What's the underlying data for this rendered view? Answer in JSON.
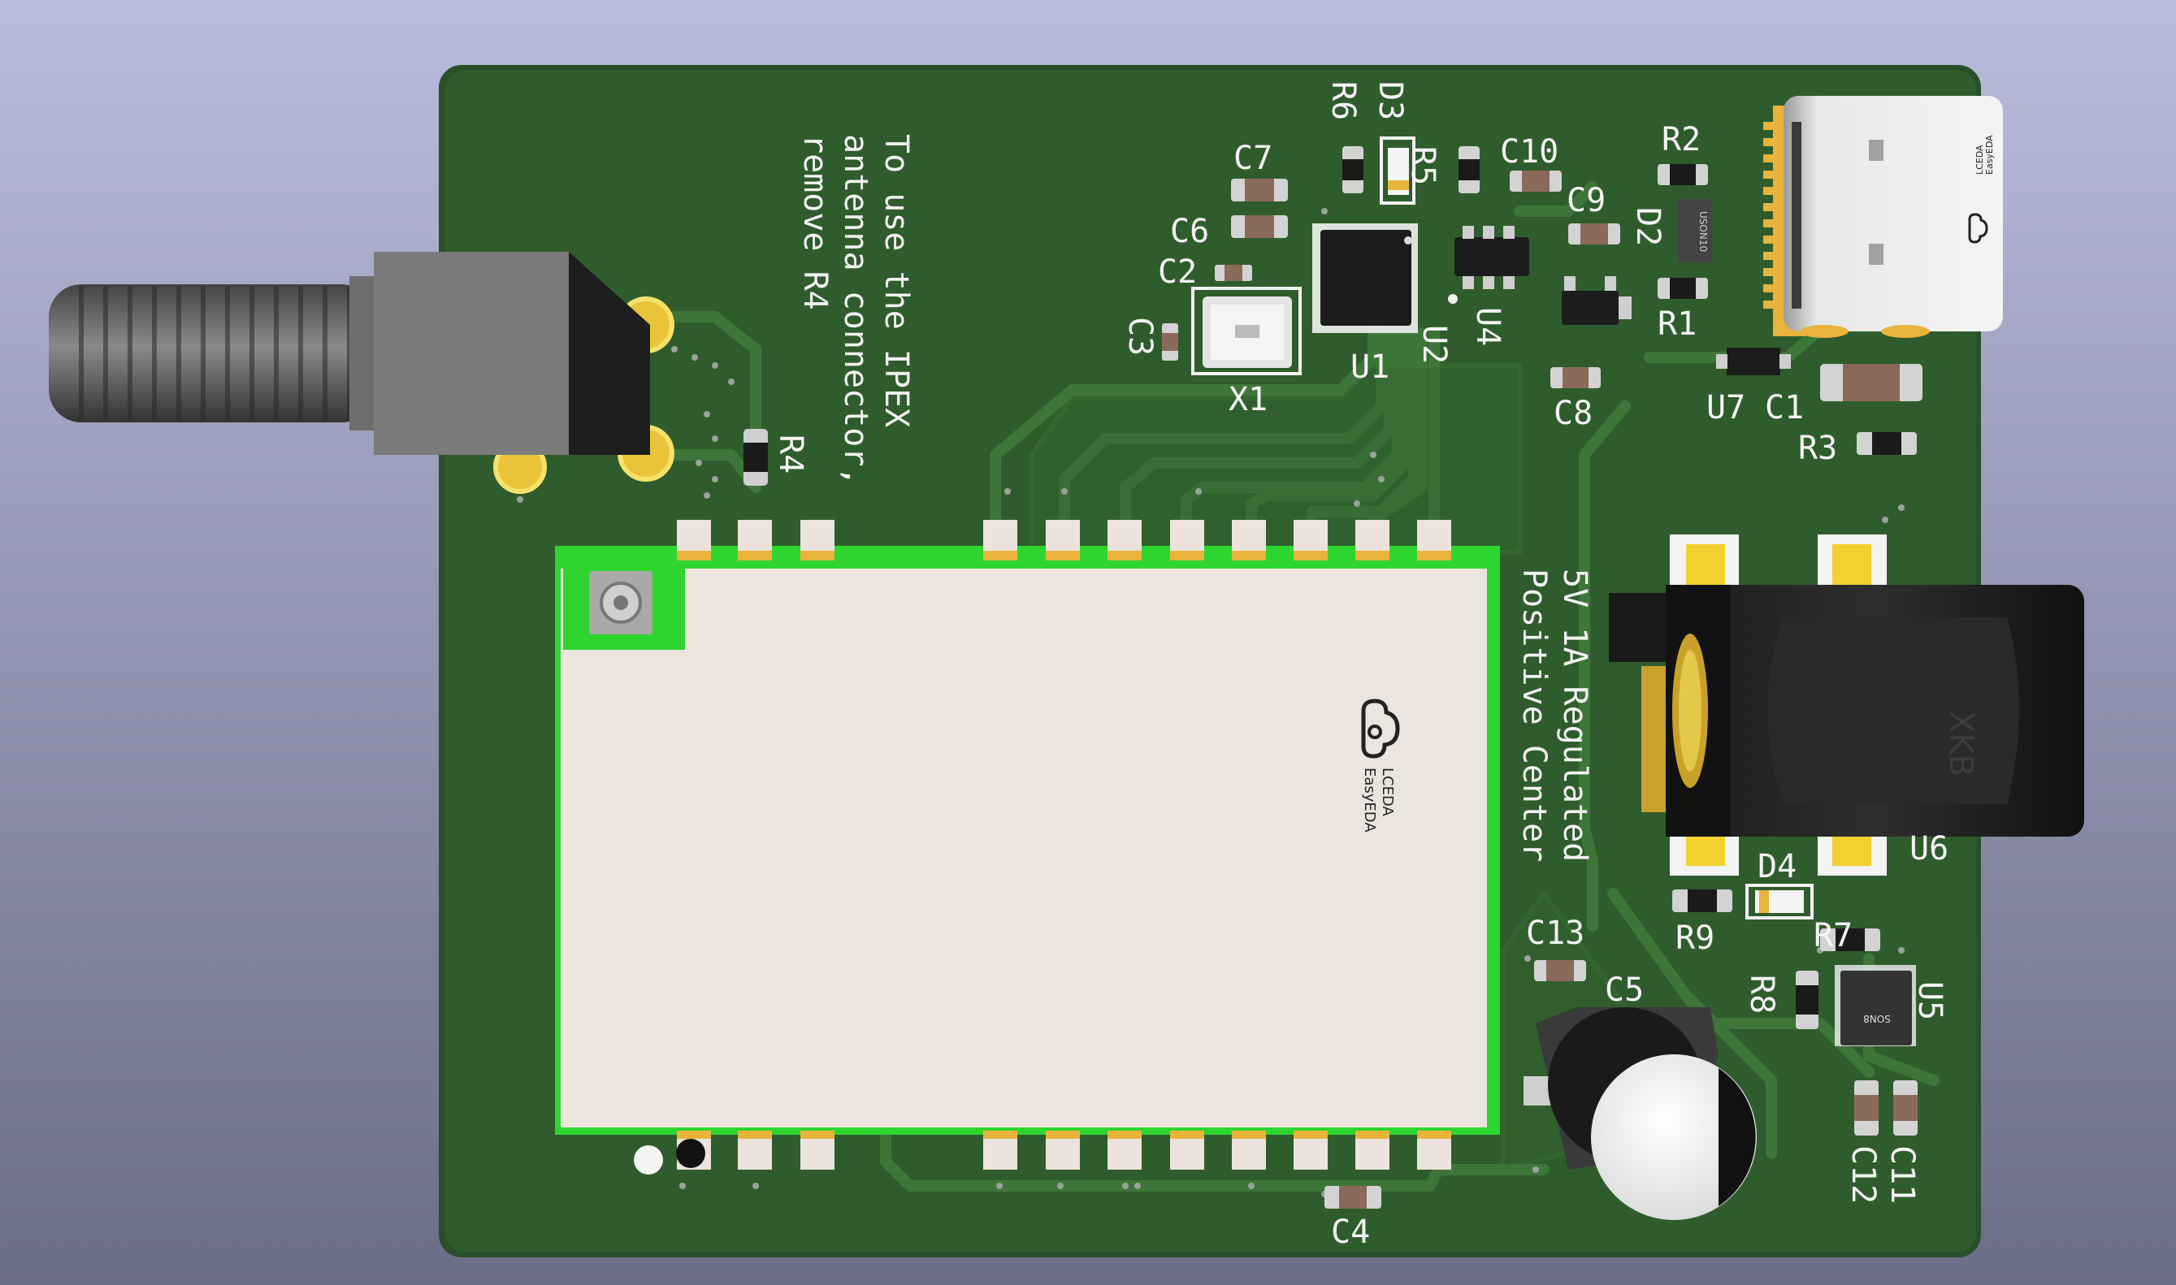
{
  "viewer": {
    "background_top": "#b8bbd9",
    "background_bottom": "#6c6f88",
    "board_color": "#2e5a2a",
    "trace_color": "#3f7a38",
    "silk_color": "#f2f2f2",
    "pad_color": "#e8b43c",
    "module_outline_color": "#2cd22c",
    "module_color": "#ece4dc",
    "copper_pour_color": "#356d31"
  },
  "board_text": {
    "ipex_note": [
      "To use the IPEX",
      "antenna connector,",
      "remove R4"
    ],
    "power_note": [
      "5V 1A Regulated",
      "Positive Center"
    ],
    "module_logo": [
      "LCEDA",
      "EasyEDA"
    ],
    "usb_logo": [
      "LCEDA",
      "EasyEDA"
    ],
    "d2_marking": "USON10",
    "u5_marking": "SON8",
    "jack_marking": "XKB"
  },
  "designators": {
    "R6": "R6",
    "D3": "D3",
    "R5": "R5",
    "C10": "C10",
    "R2": "R2",
    "C7": "C7",
    "C6": "C6",
    "C2": "C2",
    "C3": "C3",
    "X1": "X1",
    "C9": "C9",
    "D2": "D2",
    "R1": "R1",
    "U1": "U1",
    "U2": "U2",
    "U4": "U4",
    "C8": "C8",
    "U7": "U7",
    "C1": "C1",
    "R3": "R3",
    "R4": "R4",
    "U6": "U6",
    "D4": "D4",
    "R9": "R9",
    "C13": "C13",
    "R7": "R7",
    "C5": "C5",
    "R8": "R8",
    "U5": "U5",
    "C12": "C12",
    "C11": "C11",
    "C4": "C4"
  },
  "icons": {
    "module_logo": "cloud-logo-icon",
    "usb_logo": "cloud-logo-icon"
  }
}
